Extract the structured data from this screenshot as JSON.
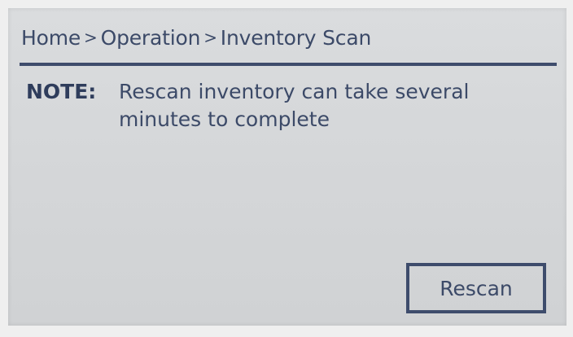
{
  "breadcrumb": {
    "items": [
      "Home",
      "Operation",
      "Inventory Scan"
    ],
    "separator": ">"
  },
  "note": {
    "label": "NOTE:",
    "text": "Rescan inventory can take several minutes to complete"
  },
  "actions": {
    "rescan_label": "Rescan"
  },
  "colors": {
    "screen_bg": "#d6d8da",
    "text": "#3c4a68",
    "accent": "#3e4c6c"
  }
}
